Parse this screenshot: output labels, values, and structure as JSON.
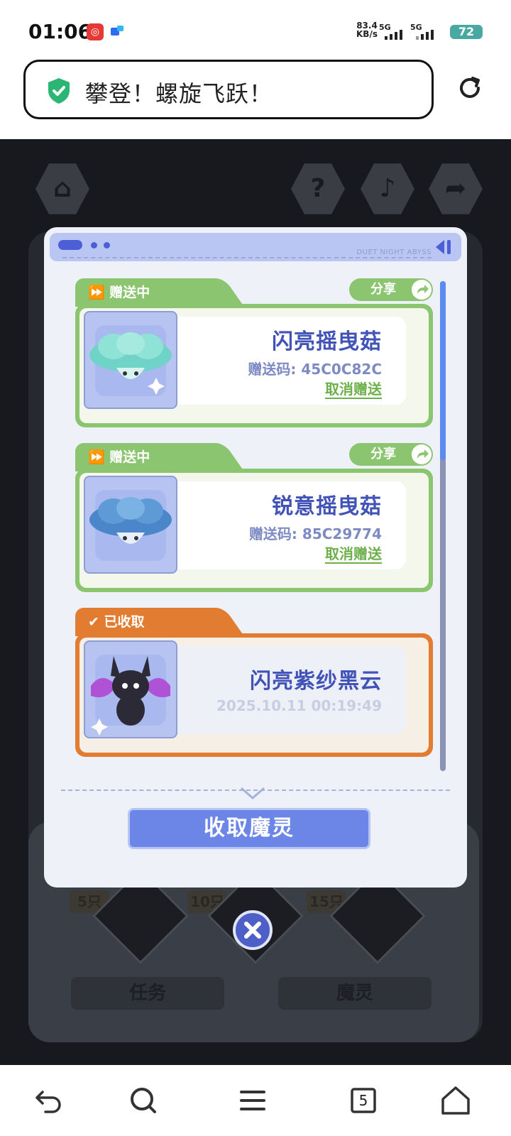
{
  "status_bar": {
    "time": "01:06",
    "app_icon_1": "netease-music-icon",
    "app_icon_2": "app-notification-icon",
    "net_speed_value": "83.4",
    "net_speed_unit": "KB/s",
    "sim1_label": "5G",
    "sim2_label": "5G",
    "battery": "72"
  },
  "browser": {
    "page_title": "攀登！螺旋飞跃！",
    "secure_icon": "shield-check-icon",
    "reload_icon": "reload-icon"
  },
  "game": {
    "top_buttons": [
      "home-icon",
      "help-icon",
      "music-icon",
      "share-icon"
    ],
    "levels": [
      "5只",
      "10只",
      "15只"
    ],
    "tabs": [
      "任务",
      "魔灵"
    ]
  },
  "modal": {
    "brand_text": "DUET NIGHT ABYSS",
    "items": [
      {
        "status": "赠送中",
        "share_label": "分享",
        "name": "闪亮摇曳菇",
        "code_label": "赠送码: 45C0C82C",
        "cancel_label": "取消赠送"
      },
      {
        "status": "赠送中",
        "share_label": "分享",
        "name": "锐意摇曳菇",
        "code_label": "赠送码: 85C29774",
        "cancel_label": "取消赠送"
      },
      {
        "status": "已收取",
        "name": "闪亮紫纱黑云",
        "datetime": "2025.10.11 00:19:49"
      }
    ],
    "collect_button": "收取魔灵",
    "close_icon": "close-icon"
  },
  "nav": {
    "items": [
      "back-icon",
      "search-icon",
      "menu-icon",
      "tabs-icon",
      "home-icon"
    ],
    "tabs_count": "5"
  },
  "colors": {
    "green": "#8cc56f",
    "orange": "#e27c31",
    "accent": "#6b86e6",
    "title_blue": "#4253b8"
  }
}
